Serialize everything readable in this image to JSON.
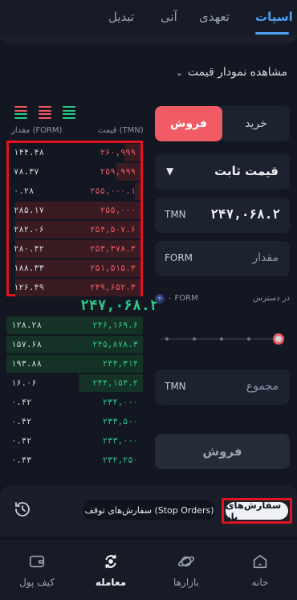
{
  "tabs": [
    {
      "label": "اسپات",
      "active": true
    },
    {
      "label": "تعهدی",
      "active": false
    },
    {
      "label": "آنی",
      "active": false
    },
    {
      "label": "تبدیل",
      "active": false
    }
  ],
  "chart_toggle": {
    "label": "مشاهده نمودار قیمت"
  },
  "order_book": {
    "header_price": "قیمت (TMN)",
    "header_amount": "مقدار (FORM)",
    "asks": [
      {
        "price": "۲۶۰,۹۹۹",
        "amount": "۱۴۴.۴۸",
        "depth": 0.12
      },
      {
        "price": "۲۵۹,۹۹۹",
        "amount": "۷۸.۳۷",
        "depth": 0.18
      },
      {
        "price": "۲۵۵,۰۰۰.۱",
        "amount": "۰.۲۸",
        "depth": 0.04
      },
      {
        "price": "۲۵۵,۰۰۰",
        "amount": "۲۸۵.۱۷",
        "depth": 0.95
      },
      {
        "price": "۲۵۴,۵۰۷.۶",
        "amount": "۲۸۲.۰۶",
        "depth": 0.95
      },
      {
        "price": "۲۵۳,۳۷۸.۳",
        "amount": "۲۸۰.۴۲",
        "depth": 0.95
      },
      {
        "price": "۲۵۱,۵۱۵.۳",
        "amount": "۱۸۸.۳۳",
        "depth": 0.95
      },
      {
        "price": "۲۴۹,۶۵۲.۳",
        "amount": "۱۲۶.۴۹",
        "depth": 0.95
      }
    ],
    "last_price": "۲۴۷,۰۶۸.۲",
    "bids": [
      {
        "price": "۲۴۶,۱۶۹.۶",
        "amount": "۱۲۸.۲۸",
        "depth": 1.0
      },
      {
        "price": "۲۴۵,۸۷۸.۳",
        "amount": "۱۵۷.۶۸",
        "depth": 1.0
      },
      {
        "price": "۲۴۴,۳۱۴",
        "amount": "۱۹۳.۸۸",
        "depth": 1.0
      },
      {
        "price": "۲۴۴,۱۵۳.۲",
        "amount": "۱۶.۰۶",
        "depth": 0.47
      },
      {
        "price": "۲۳۴,۰۰۰",
        "amount": "۰.۴۲",
        "depth": 0.0
      },
      {
        "price": "۲۳۳,۵۰۰",
        "amount": "۰.۴۲",
        "depth": 0.0
      },
      {
        "price": "۲۳۳,۰۰۰",
        "amount": "۰.۴۲",
        "depth": 0.0
      },
      {
        "price": "۲۳۲,۲۵۰",
        "amount": "۰.۴۳",
        "depth": 0.0
      }
    ]
  },
  "order_form": {
    "sell_tab": "فروش",
    "buy_tab": "خرید",
    "order_type": "قیمت ثابت",
    "price_unit": "TMN",
    "price_value": "۲۴۷,۰۶۸.۲",
    "amount_unit": "FORM",
    "amount_placeholder": "مقدار",
    "available_label": "در دسترس",
    "available_value": "۰ FORM",
    "total_unit": "TMN",
    "total_placeholder": "مجموع",
    "submit": "فروش",
    "slider_value": 1.0
  },
  "orders_section": {
    "open_orders": "سفارش‌های باز",
    "stop_orders": "سفارش‌های توقف (Stop Orders)"
  },
  "bottom_nav": [
    {
      "label": "خانه",
      "icon": "home-icon",
      "active": false
    },
    {
      "label": "بازارها",
      "icon": "planet-icon",
      "active": false
    },
    {
      "label": "معامله",
      "icon": "trade-icon",
      "active": true
    },
    {
      "label": "کیف پول",
      "icon": "wallet-icon",
      "active": false
    }
  ],
  "colors": {
    "accent": "#4fa0f5",
    "sell": "#f15b63",
    "buy": "#2ec784",
    "highlight": "#e0131e"
  }
}
